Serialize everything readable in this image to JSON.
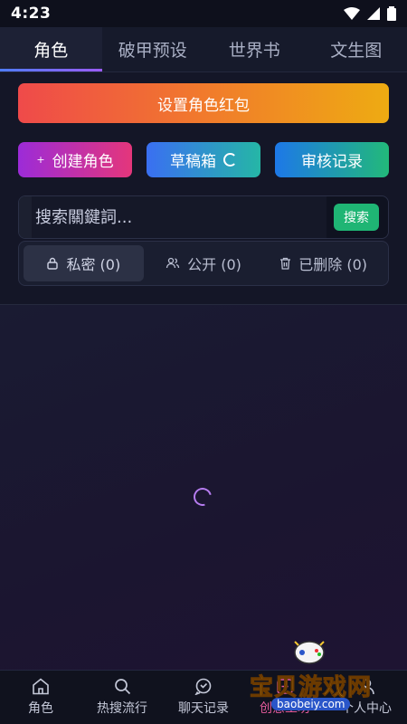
{
  "status_bar": {
    "time": "4:23"
  },
  "tabs": [
    {
      "label": "角色",
      "active": true
    },
    {
      "label": "破甲预设",
      "active": false
    },
    {
      "label": "世界书",
      "active": false
    },
    {
      "label": "文生图",
      "active": false
    }
  ],
  "banner": {
    "label": "设置角色红包"
  },
  "actions": {
    "create": "创建角色",
    "draft": "草稿箱",
    "review": "审核记录"
  },
  "search": {
    "placeholder": "搜索關鍵詞...",
    "button": "搜索"
  },
  "filters": [
    {
      "label": "私密 (0)",
      "icon": "lock-icon",
      "active": true
    },
    {
      "label": "公开 (0)",
      "icon": "users-icon",
      "active": false
    },
    {
      "label": "已删除 (0)",
      "icon": "trash-icon",
      "active": false
    }
  ],
  "bottom_nav": [
    {
      "label": "角色",
      "icon": "home-icon"
    },
    {
      "label": "热搜流行",
      "icon": "search-icon"
    },
    {
      "label": "聊天记录",
      "icon": "chat-icon"
    },
    {
      "label": "创意工坊",
      "icon": "create-icon",
      "active": true
    },
    {
      "label": "个人中心",
      "icon": "user-icon"
    }
  ],
  "watermark": {
    "text": "宝贝游戏网",
    "url": "baobeiy.com"
  },
  "colors": {
    "accent_green": "#1fb574",
    "active_nav": "#e55b9c",
    "loader": "#b67cf0"
  }
}
